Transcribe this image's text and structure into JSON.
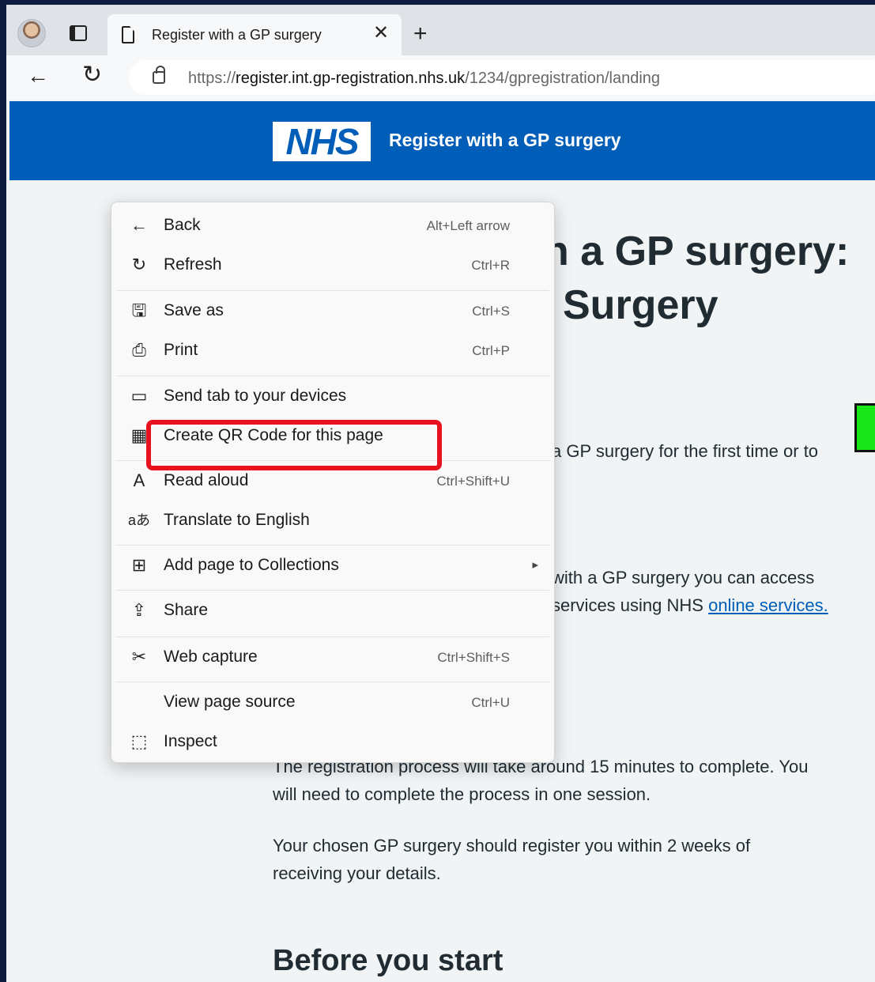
{
  "browser": {
    "tab_title": "Register with a GP surgery",
    "tab_close": "✕",
    "new_tab": "+",
    "back_glyph": "←",
    "refresh_glyph": "↻",
    "url_prefix": "https://",
    "url_host": "register.int.gp-registration.nhs.uk",
    "url_path": "/1234/gpregistration/landing"
  },
  "header": {
    "logo_text": "NHS",
    "service_name": "Register with a GP surgery"
  },
  "main": {
    "heading_line1": "n a GP surgery:",
    "heading_line2": "Surgery",
    "p1": "a GP surgery for the first time or to",
    "p2_line1": "with a GP surgery you can access",
    "p2_line2_text": "services using NHS ",
    "p2_link": "online services.",
    "p3_line1": "The registration process will take around 15 minutes to complete. You",
    "p3_line2": "will need to complete the process in one session.",
    "p4_line1": "Your chosen GP surgery should register you within 2 weeks of",
    "p4_line2": "receiving your details.",
    "before_heading": "Before you start"
  },
  "context_menu": {
    "items": [
      {
        "label": "Back",
        "shortcut": "Alt+Left arrow",
        "icon": "back-arrow-icon",
        "glyph": "←"
      },
      {
        "label": "Refresh",
        "shortcut": "Ctrl+R",
        "icon": "refresh-icon",
        "glyph": "↻"
      },
      {
        "label": "Save as",
        "shortcut": "Ctrl+S",
        "icon": "save-icon",
        "glyph": "🖫"
      },
      {
        "label": "Print",
        "shortcut": "Ctrl+P",
        "icon": "print-icon",
        "glyph": "⎙"
      },
      {
        "label": "Send tab to your devices",
        "shortcut": "",
        "icon": "devices-icon",
        "glyph": "▭"
      },
      {
        "label": "Create QR Code for this page",
        "shortcut": "",
        "icon": "qr-code-icon",
        "glyph": "▦"
      },
      {
        "label": "Read aloud",
        "shortcut": "Ctrl+Shift+U",
        "icon": "read-aloud-icon",
        "glyph": "A"
      },
      {
        "label": "Translate to English",
        "shortcut": "",
        "icon": "translate-icon",
        "glyph": "aあ"
      },
      {
        "label": "Add page to Collections",
        "shortcut": "",
        "icon": "collections-icon",
        "glyph": "⊞",
        "submenu": "▸"
      },
      {
        "label": "Share",
        "shortcut": "",
        "icon": "share-icon",
        "glyph": "⇪"
      },
      {
        "label": "Web capture",
        "shortcut": "Ctrl+Shift+S",
        "icon": "web-capture-icon",
        "glyph": "✂"
      },
      {
        "label": "View page source",
        "shortcut": "Ctrl+U",
        "icon": "",
        "glyph": ""
      },
      {
        "label": "Inspect",
        "shortcut": "",
        "icon": "inspect-icon",
        "glyph": "⬚"
      }
    ]
  },
  "colors": {
    "nhs_blue": "#005eb8",
    "highlight_red": "#e8121e",
    "marker_green": "#19e619"
  }
}
